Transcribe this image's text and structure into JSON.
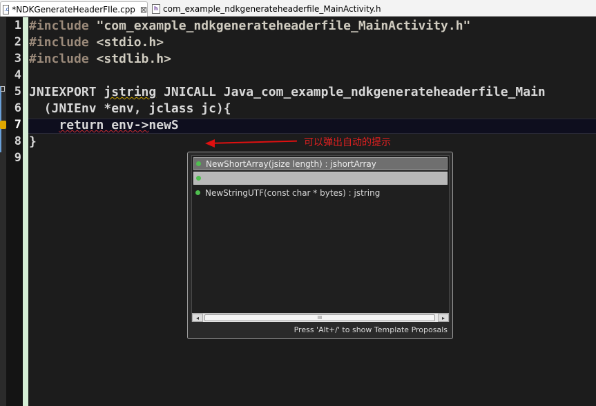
{
  "tabs": [
    {
      "label": "*NDKGenerateHeaderFIle.cpp",
      "active": true
    },
    {
      "label": "com_example_ndkgenerateheaderfile_MainActivity.h",
      "active": false
    }
  ],
  "line_numbers": [
    "1",
    "2",
    "3",
    "4",
    "5",
    "6",
    "7",
    "8",
    "9"
  ],
  "code": {
    "l1_kw": "#include",
    "l1_rest": " \"com_example_ndkgenerateheaderfile_MainActivity.h\"",
    "l2_kw": "#include",
    "l2_rest": " <stdio.h>",
    "l3_kw": "#include",
    "l3_rest": " <stdlib.h>",
    "l5_a": "JNIEXPORT ",
    "l5_b": "jstring",
    "l5_c": " JNICALL Java_com_example_ndkgenerateheaderfile_Main",
    "l6": "  (JNIEnv *env, jclass jc){",
    "l7_indent": "    ",
    "l7_a": "return env->",
    "l7_b": "newS",
    "l8": "}"
  },
  "annotation": "可以弹出自动的提示",
  "completion": {
    "items": [
      "NewShortArray(jsize length) : jshortArray",
      "",
      "NewStringUTF(const char * bytes) : jstring"
    ],
    "scroll_thumb_label": "III",
    "footer": "Press 'Alt+/' to show Template Proposals"
  },
  "colors": {
    "accent_red": "#e01010",
    "method_icon": "#4fbf4f"
  }
}
